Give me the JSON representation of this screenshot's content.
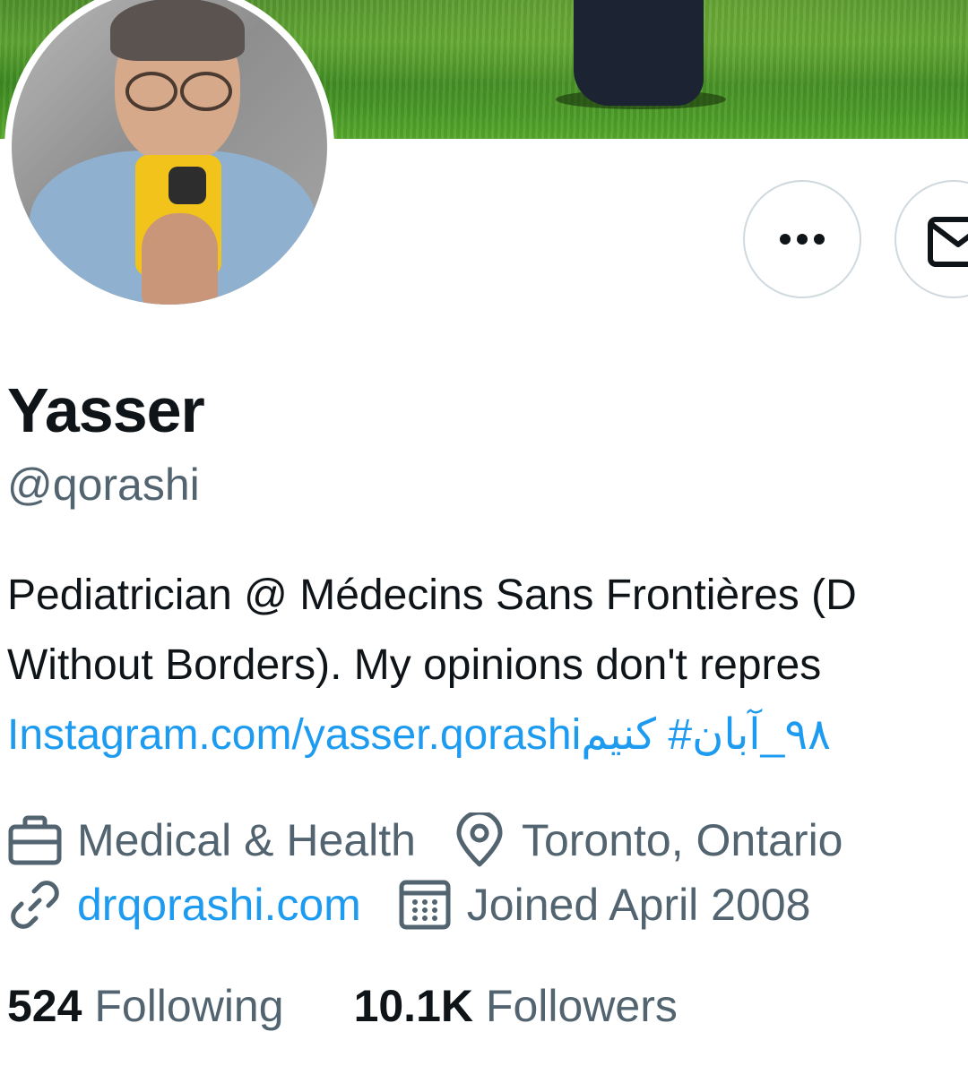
{
  "profile": {
    "name": "Yasser",
    "handle": "@qorashi",
    "bio_line_1": "Pediatrician @ Médecins Sans Frontières (D",
    "bio_line_2": "Without Borders). My opinions don't repres",
    "bio_link": "Instagram.com/yasser.qorashi",
    "bio_hashtag": " ۹۸_آبان# کنیم",
    "category": "Medical & Health",
    "location": "Toronto, Ontario",
    "website": "drqorashi.com",
    "joined": "Joined April 2008"
  },
  "stats": {
    "following_count": "524",
    "following_label": "Following",
    "followers_count": "10.1K",
    "followers_label": "Followers"
  },
  "icons": {
    "more": "more-icon",
    "message": "envelope-icon",
    "category": "briefcase-icon",
    "location": "location-pin-icon",
    "website": "link-icon",
    "joined": "calendar-icon"
  },
  "colors": {
    "link": "#1d9bf0",
    "text_primary": "#0f1419",
    "text_secondary": "#536471",
    "button_border": "#cfd9de"
  }
}
